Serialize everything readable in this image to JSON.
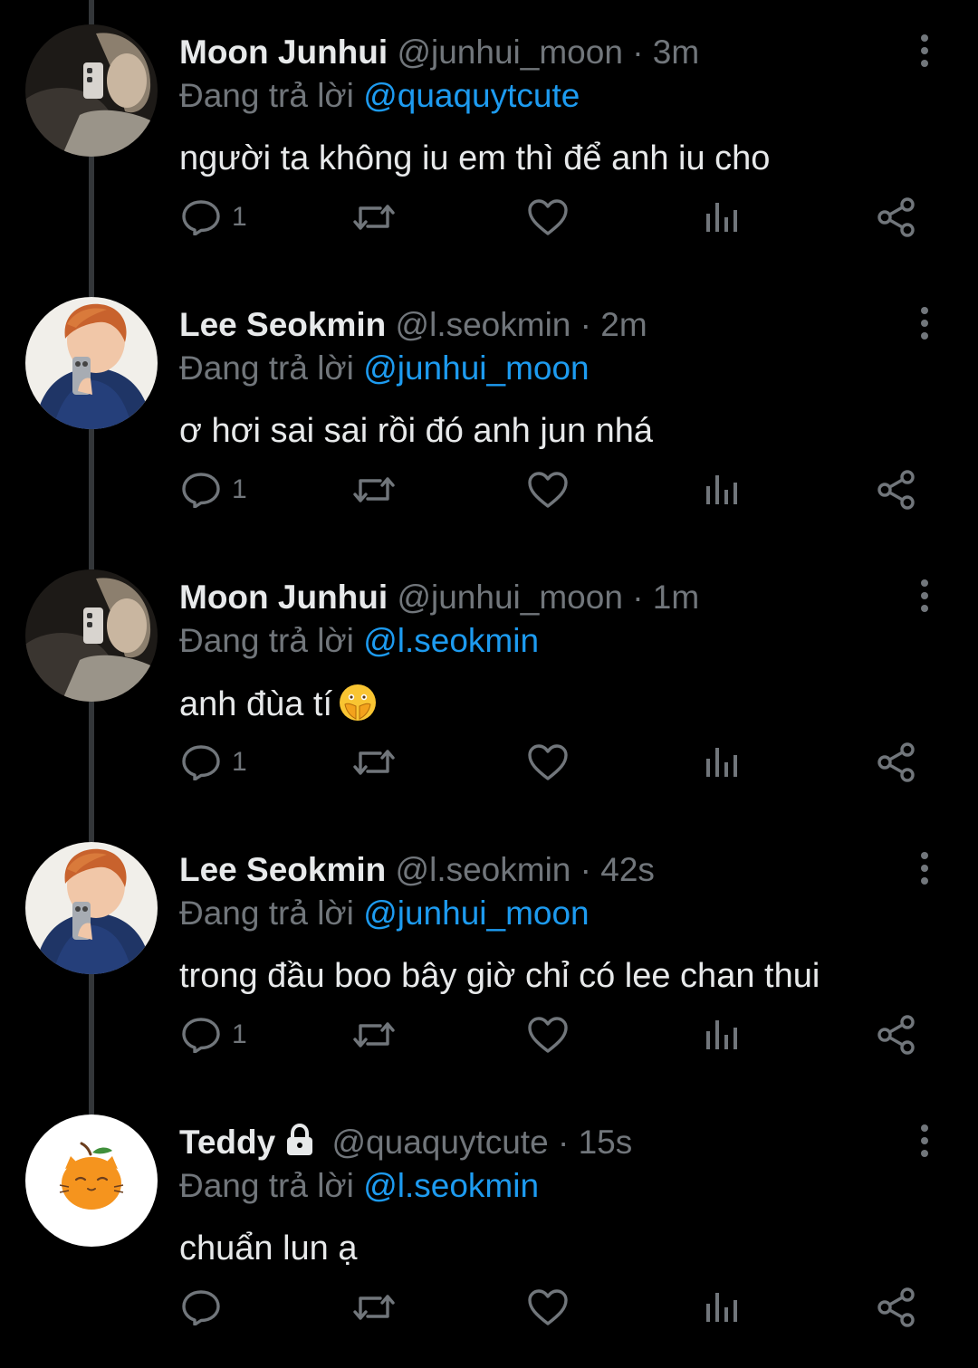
{
  "replying_label": "Đang trả lời",
  "tweets": [
    {
      "name": "Moon Junhui",
      "handle": "@junhui_moon",
      "dot": "·",
      "time": "3m",
      "reply_to": "@quaquytcute",
      "text": "người ta không iu em thì để anh iu cho",
      "reply_count": "1",
      "avatar": "junhui-avatar",
      "locked": false
    },
    {
      "name": "Lee Seokmin",
      "handle": "@l.seokmin",
      "dot": "·",
      "time": "2m",
      "reply_to": "@junhui_moon",
      "text": "ơ hơi sai sai rồi đó anh jun nhá",
      "reply_count": "1",
      "avatar": "seokmin-avatar",
      "locked": false
    },
    {
      "name": "Moon Junhui",
      "handle": "@junhui_moon",
      "dot": "·",
      "time": "1m",
      "reply_to": "@l.seokmin",
      "text": "anh đùa tí",
      "emoji": "face-with-open-eyes-and-hand-over-mouth",
      "reply_count": "1",
      "avatar": "junhui-avatar",
      "locked": false
    },
    {
      "name": "Lee Seokmin",
      "handle": "@l.seokmin",
      "dot": "·",
      "time": "42s",
      "reply_to": "@junhui_moon",
      "text": "trong đầu boo bây giờ chỉ có lee chan thui",
      "reply_count": "1",
      "avatar": "seokmin-avatar",
      "locked": false
    },
    {
      "name": "Teddy",
      "handle": "@quaquytcute",
      "dot": "·",
      "time": "15s",
      "reply_to": "@l.seokmin",
      "text": "chuẩn lun ạ",
      "reply_count": "",
      "avatar": "orange-cat-avatar",
      "locked": true
    }
  ],
  "icons": {
    "reply": "comment-icon",
    "retweet": "retweet-icon",
    "like": "heart-icon",
    "views": "views-icon",
    "share": "share-icon",
    "more": "more-vertical-icon"
  },
  "colors": {
    "background": "#000000",
    "text": "#e7e9ea",
    "secondary": "#71767b",
    "mention": "#1d9bf0",
    "thread_line": "#333639",
    "avatar_cat_orange": "#f5941e"
  }
}
